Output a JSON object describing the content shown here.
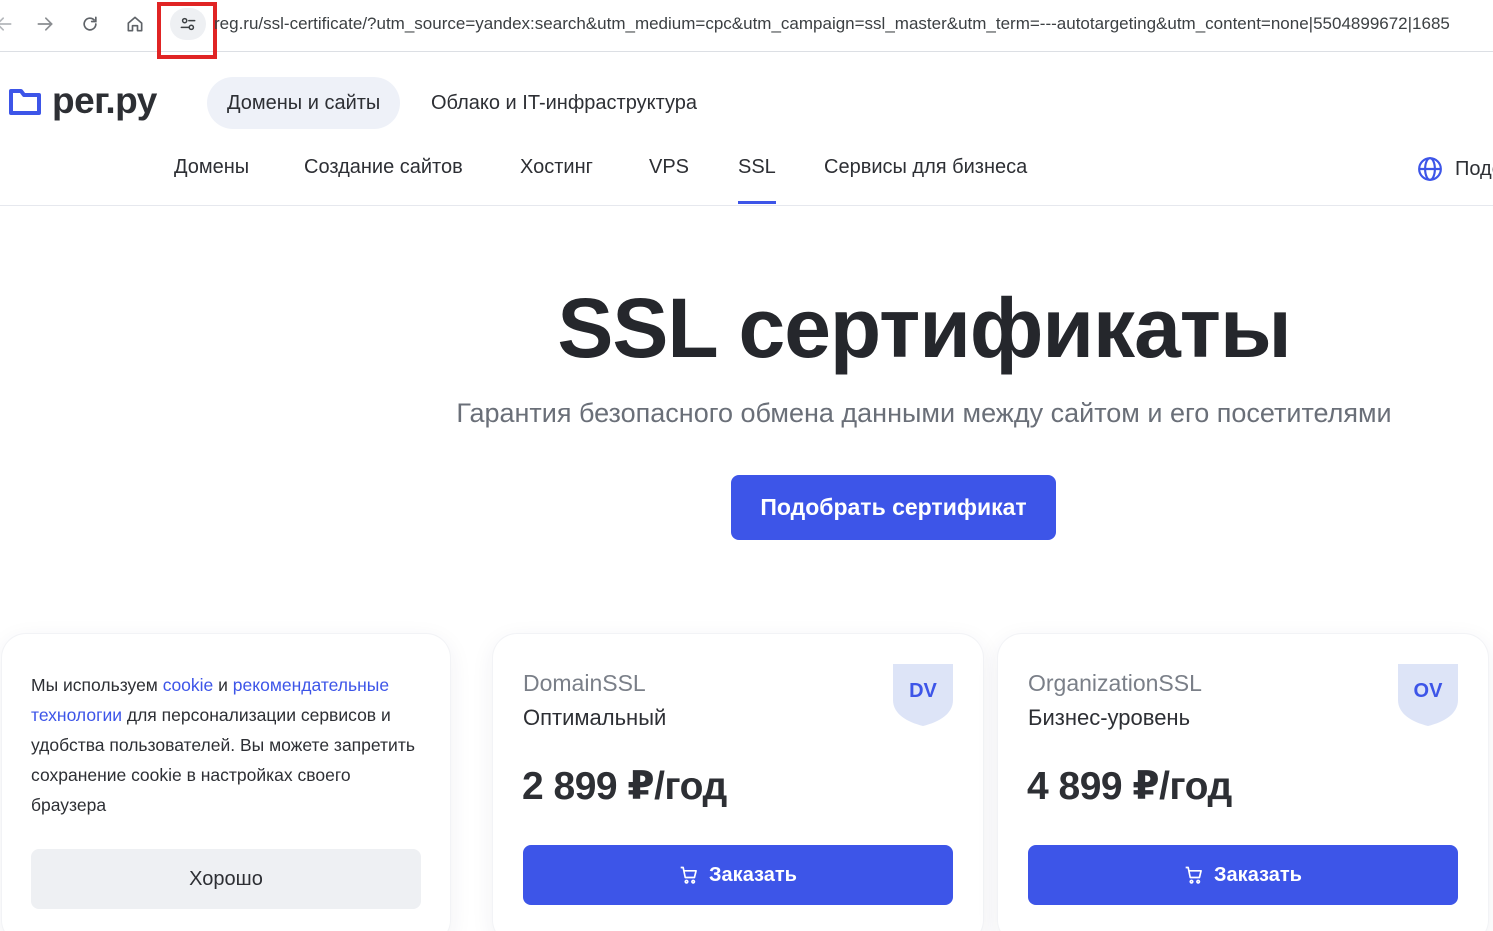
{
  "browser": {
    "url": "reg.ru/ssl-certificate/?utm_source=yandex:search&utm_medium=cpc&utm_campaign=ssl_master&utm_term=---autotargeting&utm_content=none|5504899672|1685"
  },
  "header": {
    "logo_text": "рег.ру",
    "top_tabs": [
      "Домены и сайты",
      "Облако и IT-инфраструктура"
    ],
    "nav": [
      "Домены",
      "Создание сайтов",
      "Хостинг",
      "VPS",
      "SSL",
      "Сервисы для бизнеса"
    ],
    "lang_label": "Подс"
  },
  "hero": {
    "title": "SSL сертификаты",
    "subtitle": "Гарантия безопасного обмена данными между сайтом и его посетителями",
    "cta": "Подобрать сертификат"
  },
  "cookie": {
    "t1": "Мы используем ",
    "link1": "cookie",
    "t2": " и ",
    "link2": "рекомендательные технологии",
    "t3": " для персонализации сервисов и удобства пользователей. Вы можете запретить сохранение cookie в настройках своего браузера",
    "button": "Хорошо"
  },
  "cards": [
    {
      "name": "DomainSSL",
      "level": "Оптимальный",
      "price": "2 899 ₽/год",
      "badge": "DV",
      "button": "Заказать"
    },
    {
      "name": "OrganizationSSL",
      "level": "Бизнес-уровень",
      "price": "4 899 ₽/год",
      "badge": "OV",
      "button": "Заказать"
    }
  ],
  "colors": {
    "accent": "#3d55e8",
    "highlight": "#e02424",
    "badge_bg": "#dde4f7"
  },
  "icons": [
    "back-arrow-icon",
    "forward-arrow-icon",
    "reload-icon",
    "home-icon",
    "site-info-icon",
    "logo-folder-icon",
    "globe-icon",
    "shield-badge-icon",
    "cart-icon"
  ]
}
